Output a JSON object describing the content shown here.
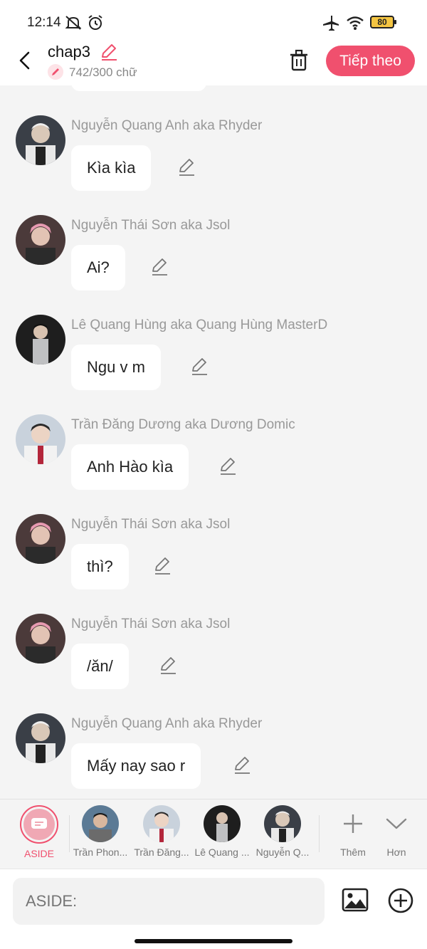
{
  "status_bar": {
    "time": "12:14",
    "battery": "80"
  },
  "header": {
    "title": "chap3",
    "word_count": "742/300 chữ",
    "next_label": "Tiếp theo"
  },
  "messages": [
    {
      "author": "Nguyễn Quang Anh aka Rhyder",
      "text": "Kìa kìa"
    },
    {
      "author": "Nguyễn Thái Sơn aka Jsol",
      "text": "Ai?"
    },
    {
      "author": "Lê Quang Hùng aka Quang Hùng MasterD",
      "text": "Ngu v m"
    },
    {
      "author": "Trần Đăng Dương aka Dương Domic",
      "text": "Anh Hào kìa"
    },
    {
      "author": "Nguyễn Thái Sơn aka Jsol",
      "text": "thì?"
    },
    {
      "author": "Nguyễn Thái Sơn aka Jsol",
      "text": "/ăn/"
    },
    {
      "author": "Nguyễn Quang Anh aka Rhyder",
      "text": "Mấy nay sao r"
    }
  ],
  "characters": {
    "aside_label": "ASIDE",
    "items": [
      {
        "name": "Trần Phon..."
      },
      {
        "name": "Trần Đăng..."
      },
      {
        "name": "Lê Quang ..."
      },
      {
        "name": "Nguyễn Q..."
      }
    ],
    "more_label": "Thêm",
    "less_label": "Hơn"
  },
  "input": {
    "placeholder": "ASIDE:"
  },
  "colors": {
    "accent": "#f0506e",
    "background": "#f4f4f4",
    "bubble": "#ffffff"
  }
}
